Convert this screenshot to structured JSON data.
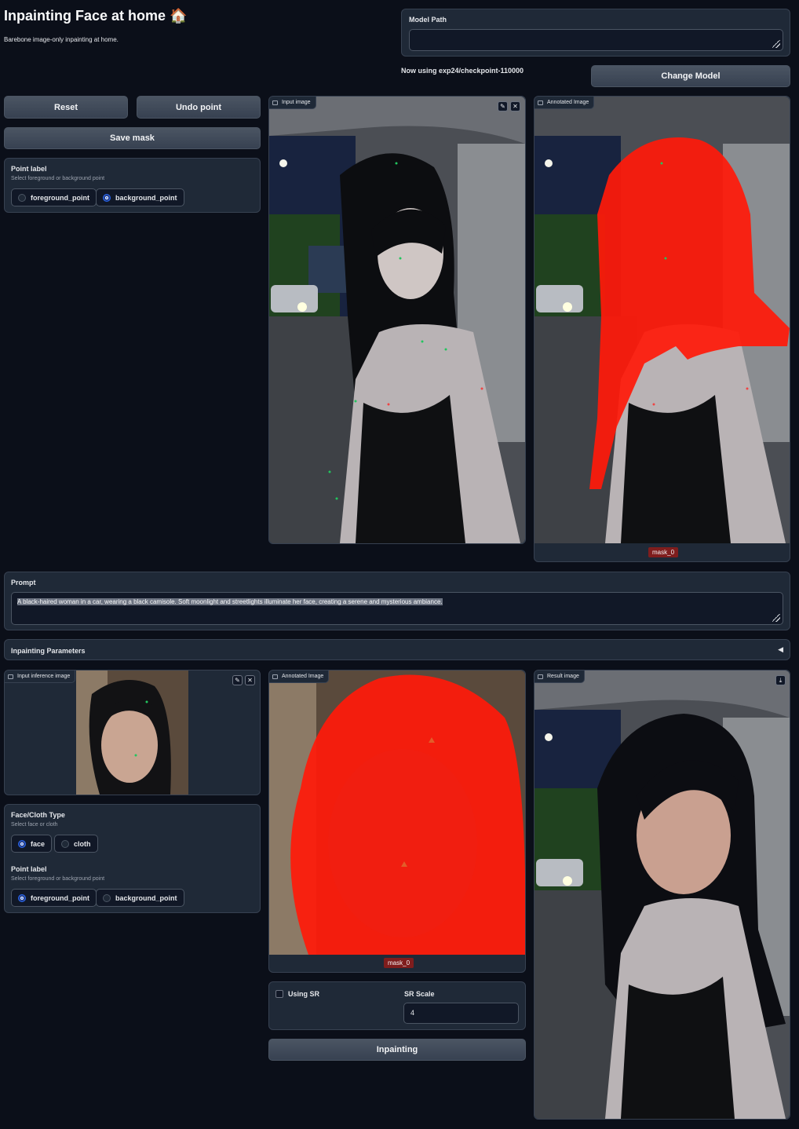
{
  "header": {
    "title": "Inpainting Face at home",
    "title_emoji": "🏠",
    "subtitle": "Barebone image-only inpainting at home."
  },
  "model": {
    "path_label": "Model Path",
    "path_value": "",
    "status": "Now using exp24/checkpoint-110000",
    "change_label": "Change Model"
  },
  "toolbar": {
    "reset_label": "Reset",
    "undo_label": "Undo point",
    "save_mask_label": "Save mask"
  },
  "point_label_top": {
    "title": "Point label",
    "hint": "Select foreground or background point",
    "options": [
      "foreground_point",
      "background_point"
    ],
    "selected": "background_point"
  },
  "images_top": {
    "input_label": "Input image",
    "annotated_label": "Annotated Image",
    "mask_badge": "mask_0"
  },
  "prompt": {
    "label": "Prompt",
    "value": "A black-haired woman in a car, wearing a black camisole. Soft moonlight and streetlights illuminate her face, creating a serene and mysterious ambiance."
  },
  "params": {
    "label": "Inpainting Parameters",
    "arrow": "◀"
  },
  "images_bottom": {
    "input_label": "Input inference image",
    "annotated_label": "Annotated Image",
    "result_label": "Result image",
    "mask_badge": "mask_0"
  },
  "face_type": {
    "title": "Face/Cloth Type",
    "hint": "Select face or cloth",
    "options": [
      "face",
      "cloth"
    ],
    "selected": "face"
  },
  "point_label_bottom": {
    "title": "Point label",
    "hint": "Select foreground or background point",
    "options": [
      "foreground_point",
      "background_point"
    ],
    "selected": "foreground_point"
  },
  "sr": {
    "using_label": "Using SR",
    "checked": false,
    "scale_label": "SR Scale",
    "scale_value": "4"
  },
  "run": {
    "inpainting_label": "Inpainting"
  },
  "colors": {
    "background": "#0b0f19",
    "panel": "#1f2937",
    "accent": "#2563eb",
    "mask": "#ff1a0a",
    "badge": "#7f1d1d"
  },
  "icons": {
    "edit": "pencil-icon",
    "clear": "close-icon",
    "image": "image-icon",
    "download": "download-icon"
  }
}
